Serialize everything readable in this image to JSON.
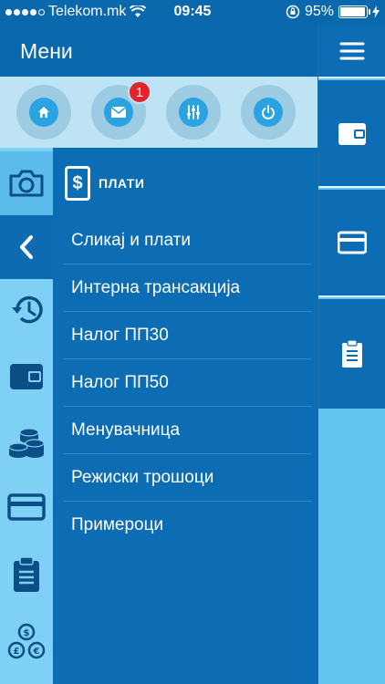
{
  "status_bar": {
    "carrier": "Telekom.mk",
    "time": "09:45",
    "battery": "95%",
    "battery_level": 0.95,
    "signal_bars_filled": 4,
    "signal_bars_total": 5
  },
  "header": {
    "title": "Мени"
  },
  "quick_actions": {
    "items": [
      {
        "icon": "home-icon"
      },
      {
        "icon": "mail-icon",
        "badge": "1"
      },
      {
        "icon": "sliders-icon"
      },
      {
        "icon": "power-icon"
      }
    ]
  },
  "left_rail": {
    "items": [
      {
        "icon": "camera-icon",
        "selected": true
      },
      {
        "icon": "chevron-left-icon"
      },
      {
        "icon": "history-icon"
      },
      {
        "icon": "wallet-icon"
      },
      {
        "icon": "coins-icon"
      },
      {
        "icon": "credit-card-icon"
      },
      {
        "icon": "clipboard-icon"
      },
      {
        "icon": "currency-exchange-icon"
      }
    ]
  },
  "submenu": {
    "header_icon": "$",
    "title": "ПЛАТИ",
    "items": [
      "Сликај и плати",
      "Интерна трансакција",
      "Налог ПП30",
      "Налог ПП50",
      "Менувачница",
      "Режиски трошоци",
      "Примероци"
    ]
  },
  "right_bar": {
    "items": [
      {
        "icon": "hamburger-menu-icon"
      },
      {
        "icon": "wallet-icon"
      },
      {
        "icon": "credit-card-icon"
      },
      {
        "icon": "clipboard-icon"
      }
    ]
  },
  "colors": {
    "primary": "#0c6cb4",
    "light": "#7ed0f4",
    "badge": "#e3222b"
  }
}
